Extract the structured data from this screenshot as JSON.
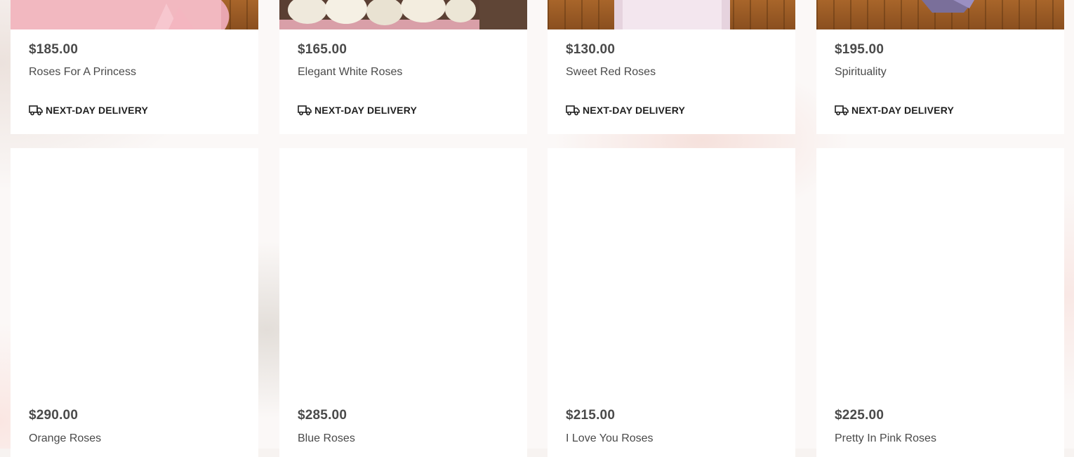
{
  "products": [
    {
      "price": "$185.00",
      "name": "Roses For A Princess",
      "delivery": "NEXT-DAY DELIVERY"
    },
    {
      "price": "$165.00",
      "name": "Elegant White Roses",
      "delivery": "NEXT-DAY DELIVERY"
    },
    {
      "price": "$130.00",
      "name": "Sweet Red Roses",
      "delivery": "NEXT-DAY DELIVERY"
    },
    {
      "price": "$195.00",
      "name": "Spirituality",
      "delivery": "NEXT-DAY DELIVERY"
    },
    {
      "price": "$290.00",
      "name": "Orange Roses"
    },
    {
      "price": "$285.00",
      "name": "Blue Roses"
    },
    {
      "price": "$215.00",
      "name": "I Love You Roses"
    },
    {
      "price": "$225.00",
      "name": "Pretty In Pink Roses"
    }
  ],
  "icons": {
    "delivery": "delivery-truck-icon"
  },
  "colors": {
    "text": "#4a4a4a",
    "delivery_text": "#1f1f1f",
    "card": "#ffffff"
  }
}
